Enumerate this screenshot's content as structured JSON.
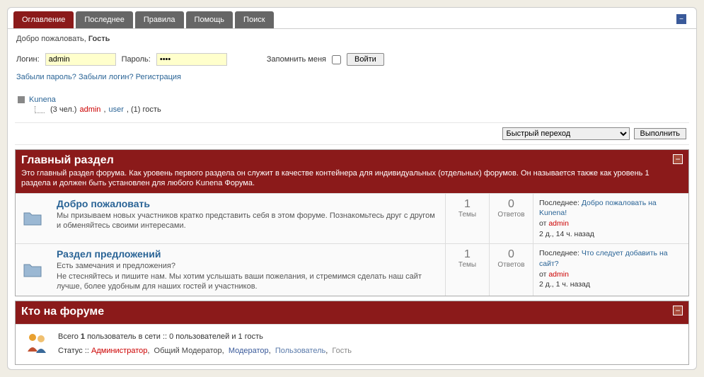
{
  "tabs": [
    "Оглавление",
    "Последнее",
    "Правила",
    "Помощь",
    "Поиск"
  ],
  "welcome": {
    "prefix": "Добро пожаловать, ",
    "user": "Гость"
  },
  "login": {
    "login_label": "Логин:",
    "login_value": "admin",
    "pass_label": "Пароль:",
    "pass_value": "••••",
    "remember": "Запомнить меня",
    "submit": "Войти"
  },
  "links": {
    "forgot_pass": "Забыли пароль?",
    "forgot_login": "Забыли логин?",
    "register": "Регистрация"
  },
  "breadcrumb": {
    "root": "Kunena",
    "sub_prefix": "(3 чел.) ",
    "admin": "admin",
    "sep1": ", ",
    "user": "user",
    "tail": ", (1) гость"
  },
  "jump": {
    "placeholder": "Быстрый переход",
    "submit": "Выполнить"
  },
  "main_section": {
    "title": "Главный раздел",
    "desc": "Это главный раздел форума. Как уровень первого раздела он служит в качестве контейнера для индивидуальных (отдельных) форумов. Он называется также как уровень 1 раздела и должен быть установлен для любого Kunena Форума."
  },
  "forums": [
    {
      "title": "Добро пожаловать",
      "desc": "Мы призываем новых участников кратко представить себя в этом форуме. Познакомьтесь друг с другом и обменяйтесь своими интересами.",
      "topics": "1",
      "topics_lbl": "Темы",
      "replies": "0",
      "replies_lbl": "Ответов",
      "last_prefix": "Последнее: ",
      "last_link": "Добро пожаловать на Kunena!",
      "by_prefix": "от ",
      "by": "admin",
      "when": "2 д., 14 ч. назад"
    },
    {
      "title": "Раздел предложений",
      "desc_line1": "Есть замечания и предложения?",
      "desc_line2": "Не стесняйтесь и пишите нам. Мы хотим услышать ваши пожелания, и стремимся сделать наш сайт лучше, более удобным для наших гостей и участников.",
      "topics": "1",
      "topics_lbl": "Темы",
      "replies": "0",
      "replies_lbl": "Ответов",
      "last_prefix": "Последнее: ",
      "last_link": "Что следует добавить на сайт?",
      "by_prefix": "от ",
      "by": "admin",
      "when": "2 д., 1 ч. назад"
    }
  ],
  "who": {
    "title": "Кто на форуме",
    "line1_a": "Всего ",
    "line1_b": "1",
    "line1_c": " пользователь в сети  ::  0 пользователей и 1 гость",
    "status_label": "Статус ::  ",
    "s_admin": "Администратор",
    "s_gmod": "Общий Модератор",
    "s_mod": "Модератор",
    "s_user": "Пользователь",
    "s_guest": "Гость"
  }
}
